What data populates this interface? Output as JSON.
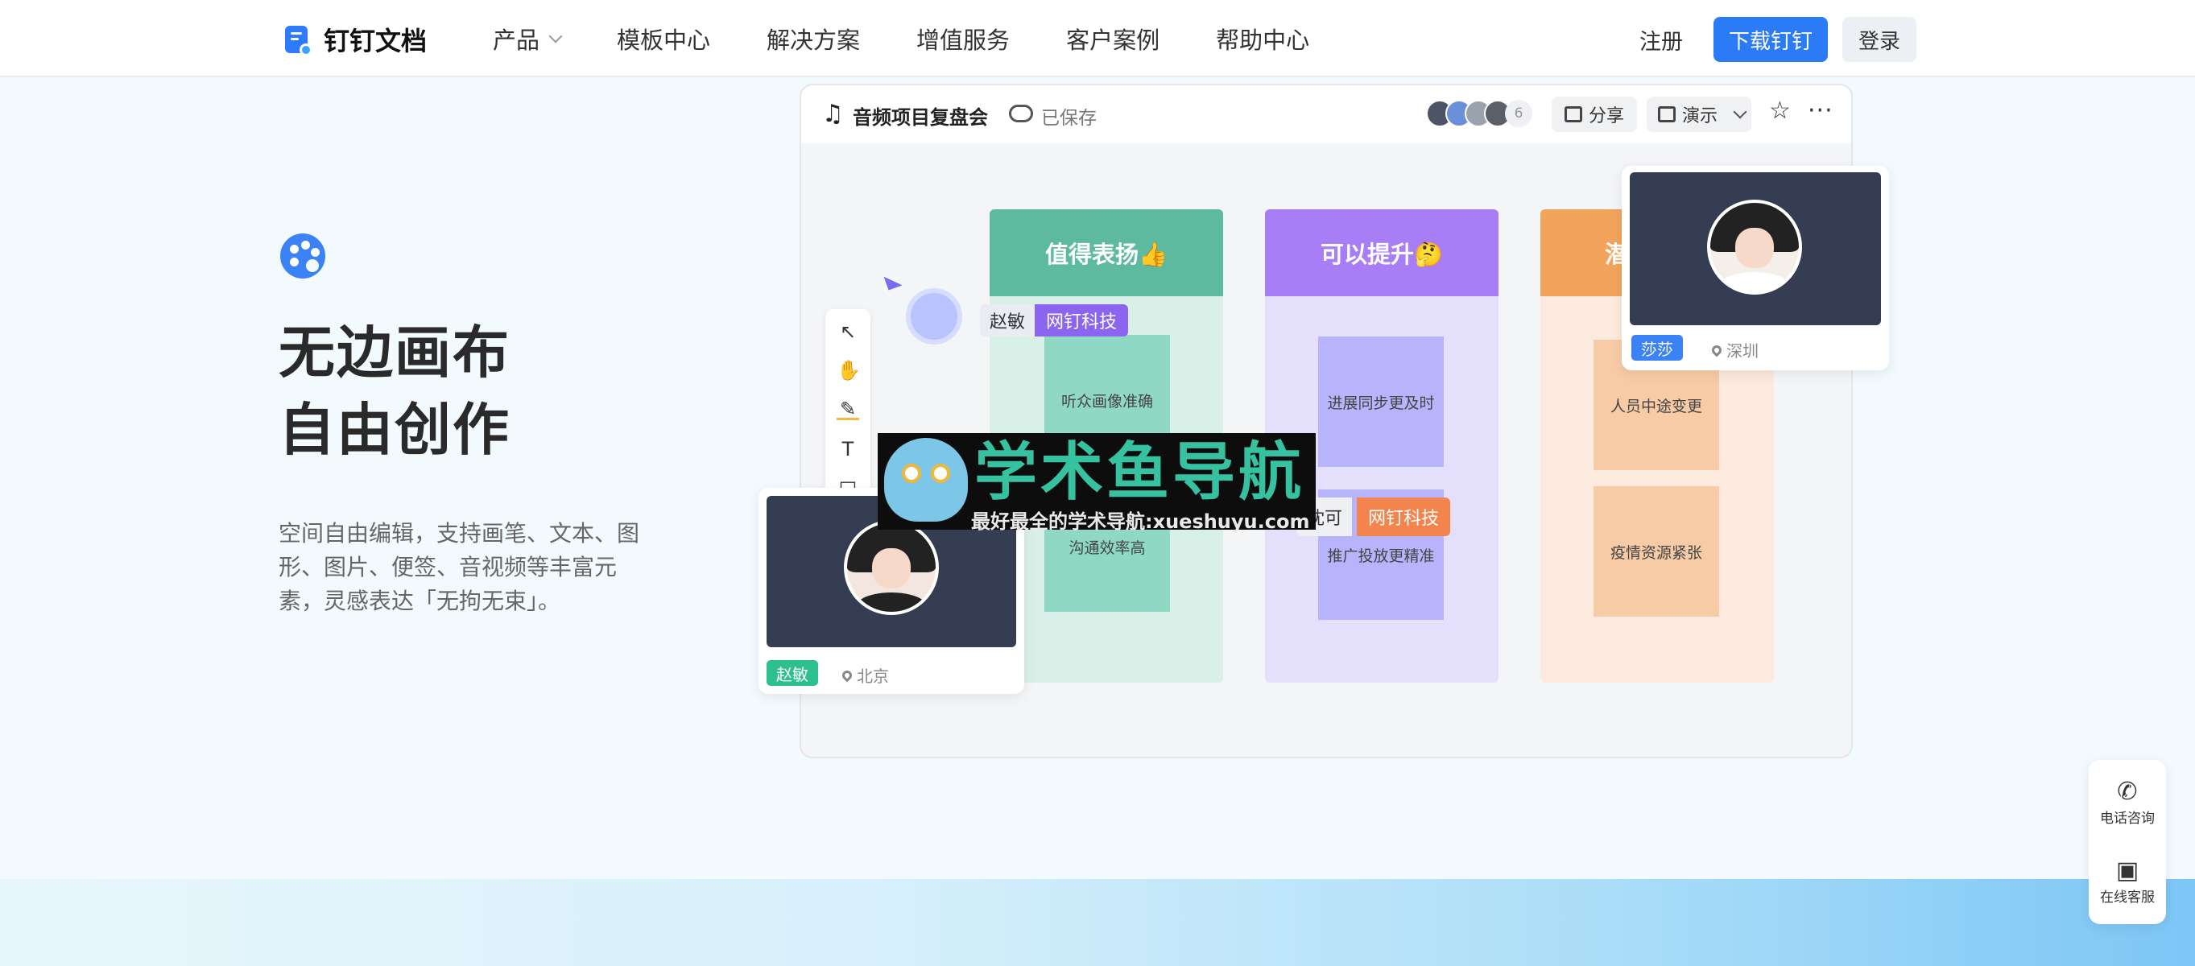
{
  "nav": {
    "logo_text": "钉钉文档",
    "menu": [
      "产品",
      "模板中心",
      "解决方案",
      "增值服务",
      "客户案例",
      "帮助中心"
    ],
    "register": "注册",
    "download": "下载钉钉",
    "login": "登录"
  },
  "hero": {
    "icon": "palette-icon",
    "title_line1": "无边画布",
    "title_line2": "自由创作",
    "description": "空间自由编辑，支持画笔、文本、图形、图片、便签、音视频等丰富元素，灵感表达「无拘无束」。"
  },
  "doc": {
    "title": "音频项目复盘会",
    "saved": "已保存",
    "collaborator_count": "6",
    "share": "分享",
    "present": "演示",
    "columns": [
      {
        "title": "值得表扬👍",
        "color": "#5dba9e",
        "bg": "#d9f0e8",
        "notes": [
          "听众画像准确",
          "沟通效率高"
        ],
        "note_color": "#8fd8c3"
      },
      {
        "title": "可以提升🤔",
        "color": "#a77ef6",
        "bg": "#e4e0fb",
        "notes": [
          "进展同步更及时",
          "推广投放更精准"
        ],
        "note_color": "#b7b4fb"
      },
      {
        "title": "潜",
        "color": "#f3a45c",
        "bg": "#fbeadd",
        "notes": [
          "人员中途变更",
          "疫情资源紧张"
        ],
        "note_color": "#f7cba6"
      }
    ],
    "cursors": [
      {
        "name": "赵敏",
        "org": "网钉科技",
        "org_color": "#8b65f0"
      },
      {
        "name": "沈可",
        "org": "网钉科技",
        "org_color": "#f4844e"
      }
    ]
  },
  "video_cards": [
    {
      "name": "赵敏",
      "location": "北京",
      "tag_color": "#2ebf8e"
    },
    {
      "name": "莎莎",
      "location": "深圳",
      "tag_color": "#3b82f6"
    }
  ],
  "watermark": {
    "title": "学术鱼导航",
    "subtitle": "最好最全的学术导航:xueshuyu.com"
  },
  "help": {
    "phone": "电话咨询",
    "service": "在线客服"
  }
}
